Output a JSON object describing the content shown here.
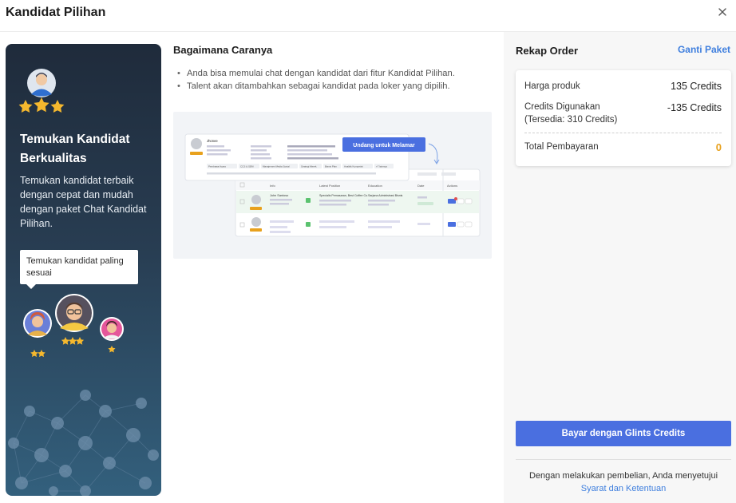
{
  "modal": {
    "title": "Kandidat Pilihan"
  },
  "promo": {
    "title": "Temukan Kandidat Berkualitas",
    "description": "Temukan kandidat terbaik dengan cepat dan mudah dengan paket Chat Kandidat Pilihan.",
    "bubble": "Temukan kandidat paling sesuai"
  },
  "how": {
    "title": "Bagaimana Caranya",
    "steps": [
      "Anda bisa memulai chat dengan kandidat dari fitur Kandidat Pilihan.",
      "Talent akan ditambahkan sebagai kandidat pada loker yang dipilih."
    ],
    "preview": {
      "invite_label": "Undang untuk Melamar",
      "candidate_name": "Jhonee",
      "tags": [
        "Pembawa Acara",
        "CCS & SEM",
        "Manajemen Media Sosial",
        "Strategi Merek",
        "Bisnis Plan",
        "Analitik Kompetisi",
        "+7 lainnya"
      ],
      "columns": [
        "Info",
        "Latest Position",
        "Education",
        "Date",
        "Actions"
      ],
      "row": {
        "name": "John Santoso",
        "position": "Specialis Pemasaran, Best Coffee Co.",
        "education": "Sarjana Administrasi Bisnis"
      }
    }
  },
  "recap": {
    "title": "Rekap Order",
    "change_link": "Ganti Paket",
    "price_label": "Harga produk",
    "price_value": "135 Credits",
    "used_label": "Credits Digunakan",
    "available_label": "(Tersedia: 310 Credits)",
    "used_value": "-135 Credits",
    "total_label": "Total Pembayaran",
    "total_value": "0"
  },
  "actions": {
    "pay_button": "Bayar dengan Glints Credits",
    "footer_text": "Dengan melakukan pembelian, Anda menyetujui",
    "terms_link": "Syarat dan Ketentuan"
  },
  "colors": {
    "accent": "#4a6fe0",
    "link": "#3f7fde",
    "total_value": "#e8a11d",
    "star": "#f5b82e"
  }
}
